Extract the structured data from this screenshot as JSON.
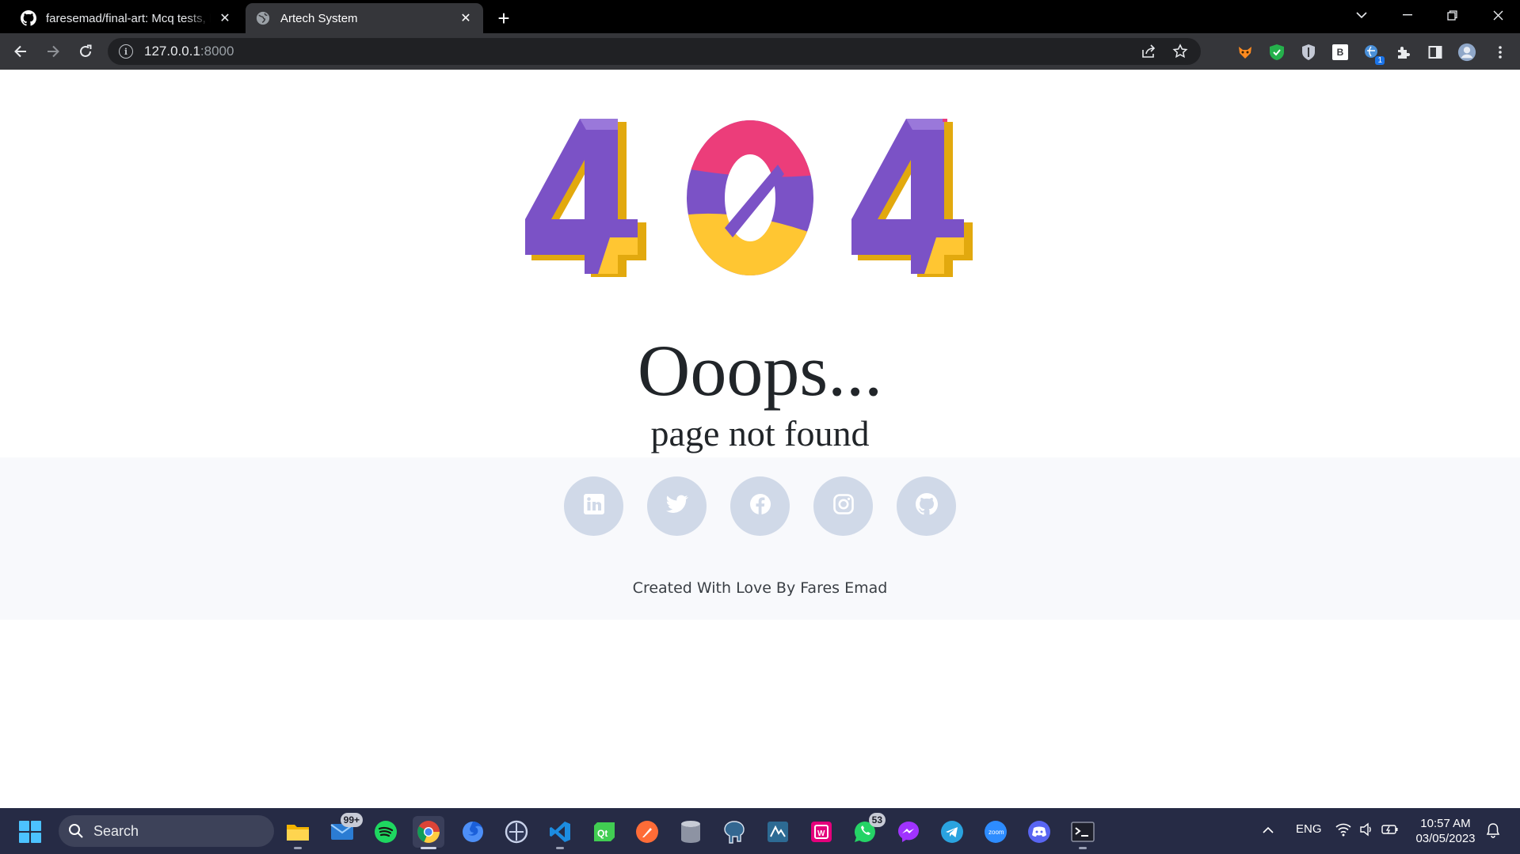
{
  "browser": {
    "tabs": [
      {
        "title": "faresemad/final-art: Mcq tests, h",
        "icon": "github-icon",
        "active": false
      },
      {
        "title": "Artech System",
        "icon": "globe-icon",
        "active": true
      }
    ],
    "url": {
      "host": "127.0.0.1",
      "port": ":8000"
    }
  },
  "page": {
    "error_code": "404",
    "heading": "Ooops...",
    "subheading": "page not found",
    "socials": [
      "linkedin-icon",
      "twitter-icon",
      "facebook-icon",
      "instagram-icon",
      "github-icon"
    ],
    "credit": "Created With Love By Fares Emad",
    "colors": {
      "purple": "#7b52c6",
      "pink": "#ec3d7a",
      "yellow": "#ffc632",
      "social_bg": "#d0d9e8"
    }
  },
  "taskbar": {
    "search_placeholder": "Search",
    "mail_badge": "99+",
    "whatsapp_badge": "53",
    "language": "ENG",
    "time": "10:57 AM",
    "date": "03/05/2023"
  },
  "extensions": {
    "notification_badge": "1",
    "b_label": "B"
  }
}
